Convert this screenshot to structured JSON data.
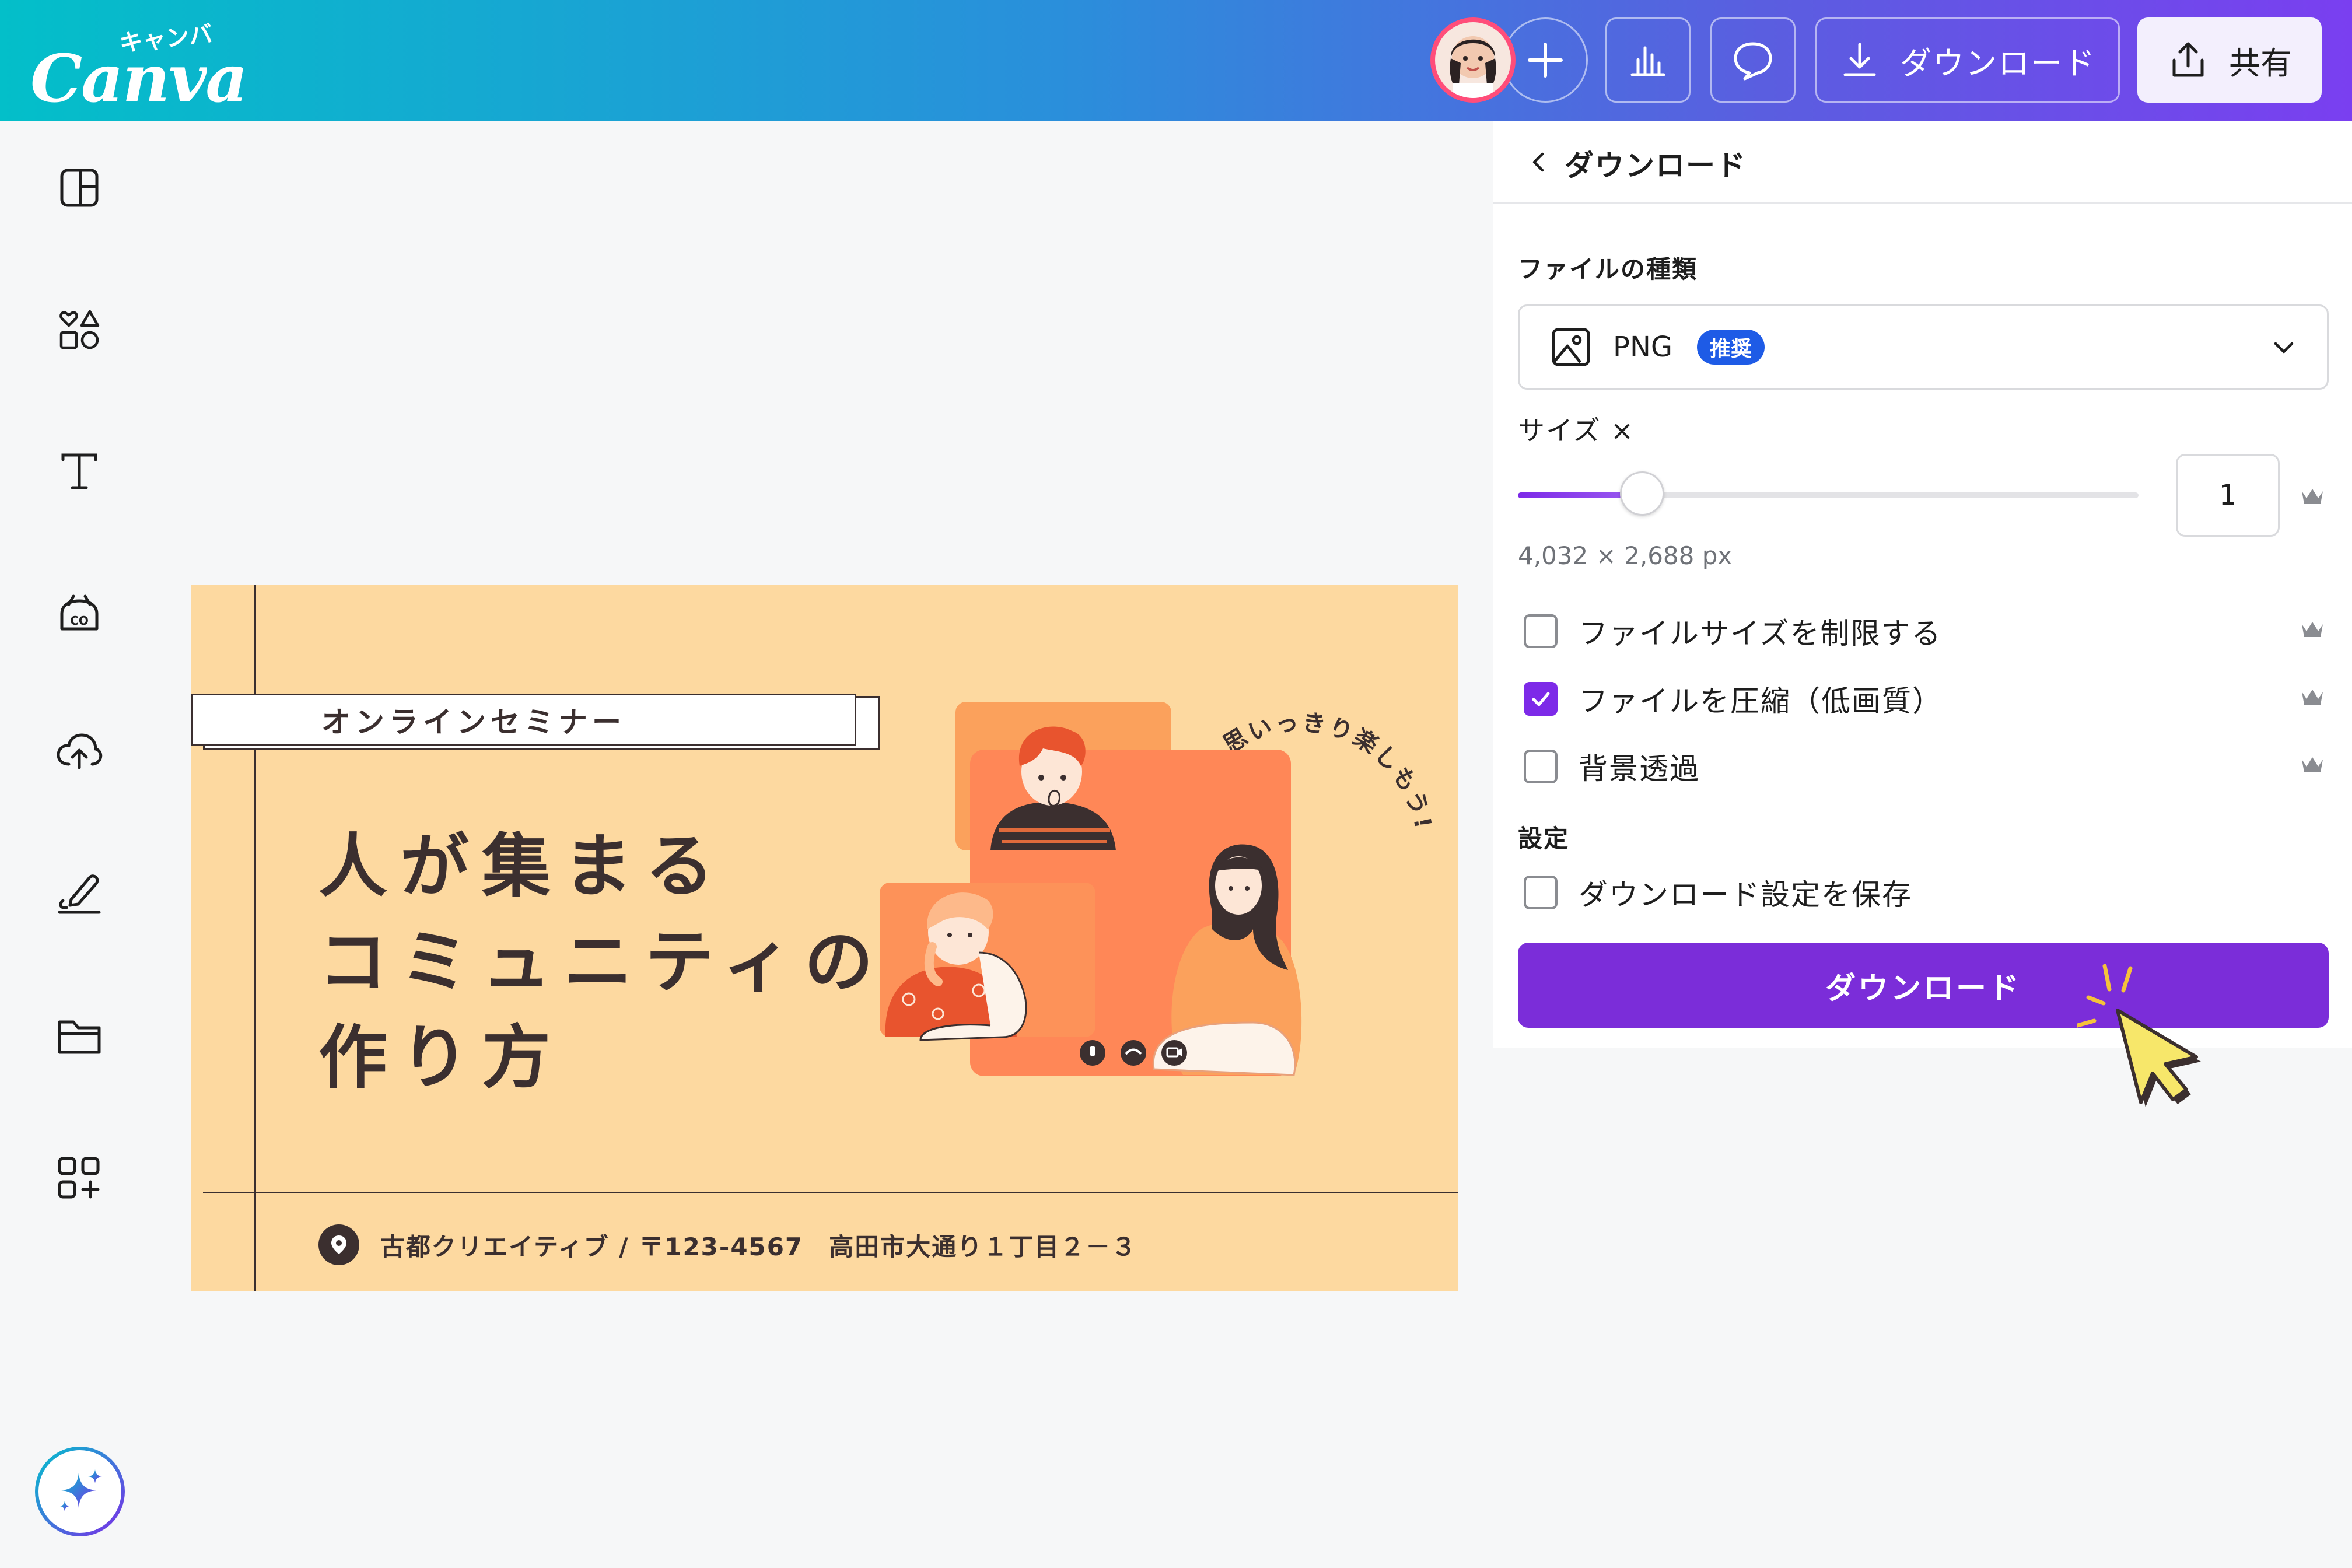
{
  "app": {
    "logo_text": "Canva",
    "logo_sub": "キャンバ",
    "brand_colors": {
      "gradient_start": "#03bfc9",
      "gradient_end": "#7a3ff0",
      "accent": "#7d2ae8"
    }
  },
  "toolbar": {
    "add_icon": "plus-icon",
    "analytics_icon": "bar-chart-icon",
    "comment_icon": "comment-icon",
    "download_label": "ダウンロード",
    "share_label": "共有"
  },
  "sidebar": {
    "items": [
      {
        "name": "design",
        "icon": "layout-icon"
      },
      {
        "name": "elements",
        "icon": "shapes-icon"
      },
      {
        "name": "text",
        "icon": "text-icon"
      },
      {
        "name": "brand",
        "icon": "brand-icon"
      },
      {
        "name": "uploads",
        "icon": "cloud-upload-icon"
      },
      {
        "name": "draw",
        "icon": "pen-icon"
      },
      {
        "name": "projects",
        "icon": "folder-icon"
      },
      {
        "name": "apps",
        "icon": "apps-icon"
      }
    ],
    "magic_icon": "sparkle-icon"
  },
  "design": {
    "tag": "オンラインセミナー",
    "headline": [
      "人が集まる",
      "コミュニティの",
      "作り方"
    ],
    "curved_text": "思いっきり楽しもう!",
    "address": "古都クリエイティブ / 〒123-4567　高田市大通り１丁目２－３",
    "background": "#fdd9a0",
    "text_color": "#3b2f2f"
  },
  "download_panel": {
    "title": "ダウンロード",
    "file_type_label": "ファイルの種類",
    "file_type": {
      "value": "PNG",
      "badge": "推奨"
    },
    "size_label": "サイズ ×",
    "size_value": "1",
    "size_ratio": 0.2,
    "dimensions": "4,032 × 2,688 px",
    "options": [
      {
        "label": "ファイルサイズを制限する",
        "checked": false,
        "premium": true
      },
      {
        "label": "ファイルを圧縮（低画質）",
        "checked": true,
        "premium": true
      },
      {
        "label": "背景透過",
        "checked": false,
        "premium": true
      }
    ],
    "settings_label": "設定",
    "save_settings": {
      "label": "ダウンロード設定を保存",
      "checked": false
    },
    "download_button": "ダウンロード"
  }
}
